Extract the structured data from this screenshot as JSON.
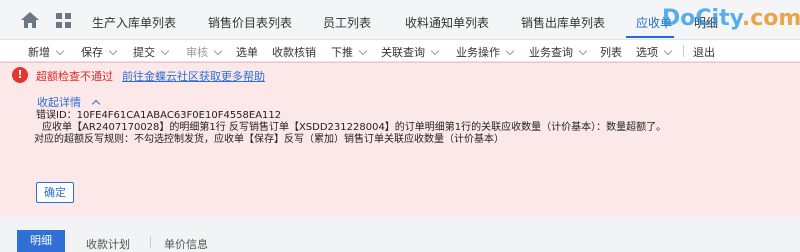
{
  "tabs": [
    {
      "label": "生产入库单列表"
    },
    {
      "label": "销售价目表列表"
    },
    {
      "label": "员工列表"
    },
    {
      "label": "收料通知单列表"
    },
    {
      "label": "销售出库单列表"
    },
    {
      "label": "应收单"
    },
    {
      "label": "明细"
    }
  ],
  "watermark": {
    "text": "DoCity",
    "tld": ".com"
  },
  "toolbar": {
    "new": "新增",
    "save": "保存",
    "submit": "提交",
    "audit": "审核",
    "select": "选单",
    "verify": "收款核销",
    "push": "下推",
    "related": "关联查询",
    "business_ops": "业务操作",
    "business_query": "业务查询",
    "list": "列表",
    "options": "选项",
    "exit": "退出"
  },
  "error": {
    "title": "超额检查不通过",
    "link": "前往金蝶云社区获取更多帮助",
    "collapse": "收起详情",
    "line1": "错误ID：10FE4F61CA1ABAC63F0E10F4558EA112",
    "line2": "应收单【AR2407170028】的明细第1行 反写销售订单【XSDD231228004】的订单明细第1行的关联应收数量（计价基本）：数量超额了。",
    "line3": "对应的超额反写规则：不勾选控制发货，应收单【保存】反写（累加）销售订单关联应收数量（计价基本）",
    "ok": "确定"
  },
  "bottom_tabs": {
    "detail": "明细",
    "plan": "收款计划",
    "price": "单价信息"
  }
}
